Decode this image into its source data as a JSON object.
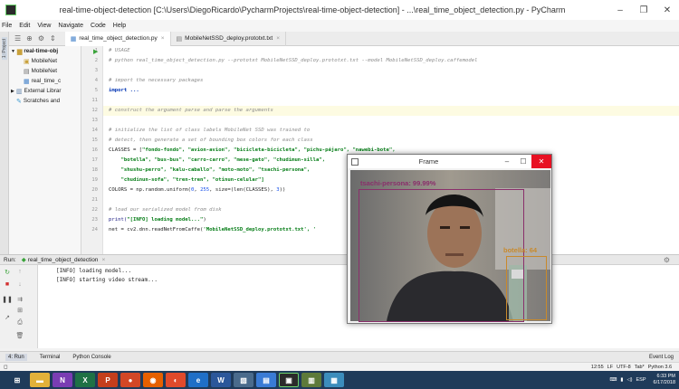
{
  "window": {
    "title": "real-time-object-detection [C:\\Users\\DiegoRicardo\\PycharmProjects\\real-time-object-detection] - ...\\real_time_object_detection.py - PyCharm"
  },
  "menu": [
    "File",
    "Edit",
    "View",
    "Navigate",
    "Code",
    "Help"
  ],
  "tabs": [
    {
      "label": "real_time_object_detection.py",
      "active": true
    },
    {
      "label": "MobileNetSSD_deploy.prototxt.txt",
      "active": false
    }
  ],
  "left_strip_label": "1: Project",
  "project_tree": [
    "real-time-obj",
    "MobileNet",
    "MobileNet",
    "real_time_c",
    "External Librar",
    "Scratches and"
  ],
  "line_numbers": [
    "1",
    "2",
    "3",
    "4",
    "5",
    "11",
    "12",
    "13",
    "14",
    "15",
    "16",
    "17",
    "18",
    "19",
    "20",
    "21",
    "22",
    "23",
    "24"
  ],
  "code": {
    "l1": "# USAGE",
    "l2": "# python real_time_object_detection.py --prototxt MobileNetSSD_deploy.prototxt.txt --model MobileNetSSD_deploy.caffemodel",
    "l3": "",
    "l4": "# import the necessary packages",
    "l5_kw": "import",
    "l5_rest": " ...",
    "l11": "",
    "l12": "# construct the argument parse and parse the arguments",
    "l13": "",
    "l14": "# initialize the list of class labels MobileNet SSD was trained to",
    "l15": "# detect, then generate a set of bounding box colors for each class",
    "l16_a": "CLASSES = [",
    "l16_b": "\"fondo-fondo\", \"avion-avion\", \"bicicleta-bicicleta\", \"pichu-pájaro\", \"nawebi-bote\",",
    "l17": "\"botella\", \"bus-bus\", \"carro-carro\", \"mese-gato\", \"chudimun-silla\",",
    "l18": "\"shushu-perro\", \"kalu-caballo\", \"moto-moto\", \"tsachi-persona\",",
    "l19": "\"chudinun-sofa\", \"tren-tren\", \"otinun-celular\"]",
    "l20_a": "COLORS = np.random.uniform(",
    "l20_b": "0",
    "l20_c": ", ",
    "l20_d": "255",
    "l20_e": ", size=(len(CLASSES), ",
    "l20_f": "3",
    "l20_g": "))",
    "l21": "",
    "l22": "# load our serialized model from disk",
    "l23_a": "print(",
    "l23_b": "\"[INFO] loading model...\"",
    "l23_c": ")",
    "l24_a": "net = cv2.dnn.readNetFromCaffe(",
    "l24_b": "'MobileNetSSD_deploy.prototxt.txt'",
    "l24_c": ", '"
  },
  "run_panel": {
    "label": "Run:",
    "config": "real_time_object_detection",
    "output": [
      "[INFO] loading model...",
      "[INFO] starting video stream..."
    ]
  },
  "tool_tabs": {
    "run": "4: Run",
    "terminal": "Terminal",
    "python_console": "Python Console",
    "event_log": "Event Log"
  },
  "status": {
    "position": "12:55",
    "line_sep": "LF",
    "encoding": "UTF-8",
    "indent": "Tab*",
    "interpreter": "Python 3.6"
  },
  "frame_window": {
    "title": "Frame",
    "detections": [
      {
        "label": "tsachi-persona: 99.99%",
        "color": "#8a2f6b"
      },
      {
        "label": "botella: 64",
        "color": "#c88a2c"
      }
    ]
  },
  "taskbar": {
    "lang": "ESP",
    "time": "6:33 PM",
    "date": "6/17/2018"
  }
}
